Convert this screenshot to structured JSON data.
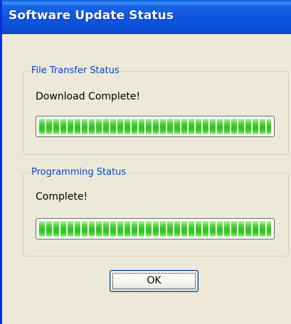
{
  "window": {
    "title": "Software Update Status"
  },
  "file_transfer": {
    "legend": "File Transfer Status",
    "status": "Download Complete!",
    "progress_percent": 100
  },
  "programming": {
    "legend": "Programming Status",
    "status": "Complete!",
    "progress_percent": 100
  },
  "buttons": {
    "ok_label": "OK"
  },
  "colors": {
    "titlebar": "#0a4fd6",
    "dialog_background": "#ece9d8",
    "legend_text": "#0046d5",
    "progress_fill": "#2cc11c"
  }
}
